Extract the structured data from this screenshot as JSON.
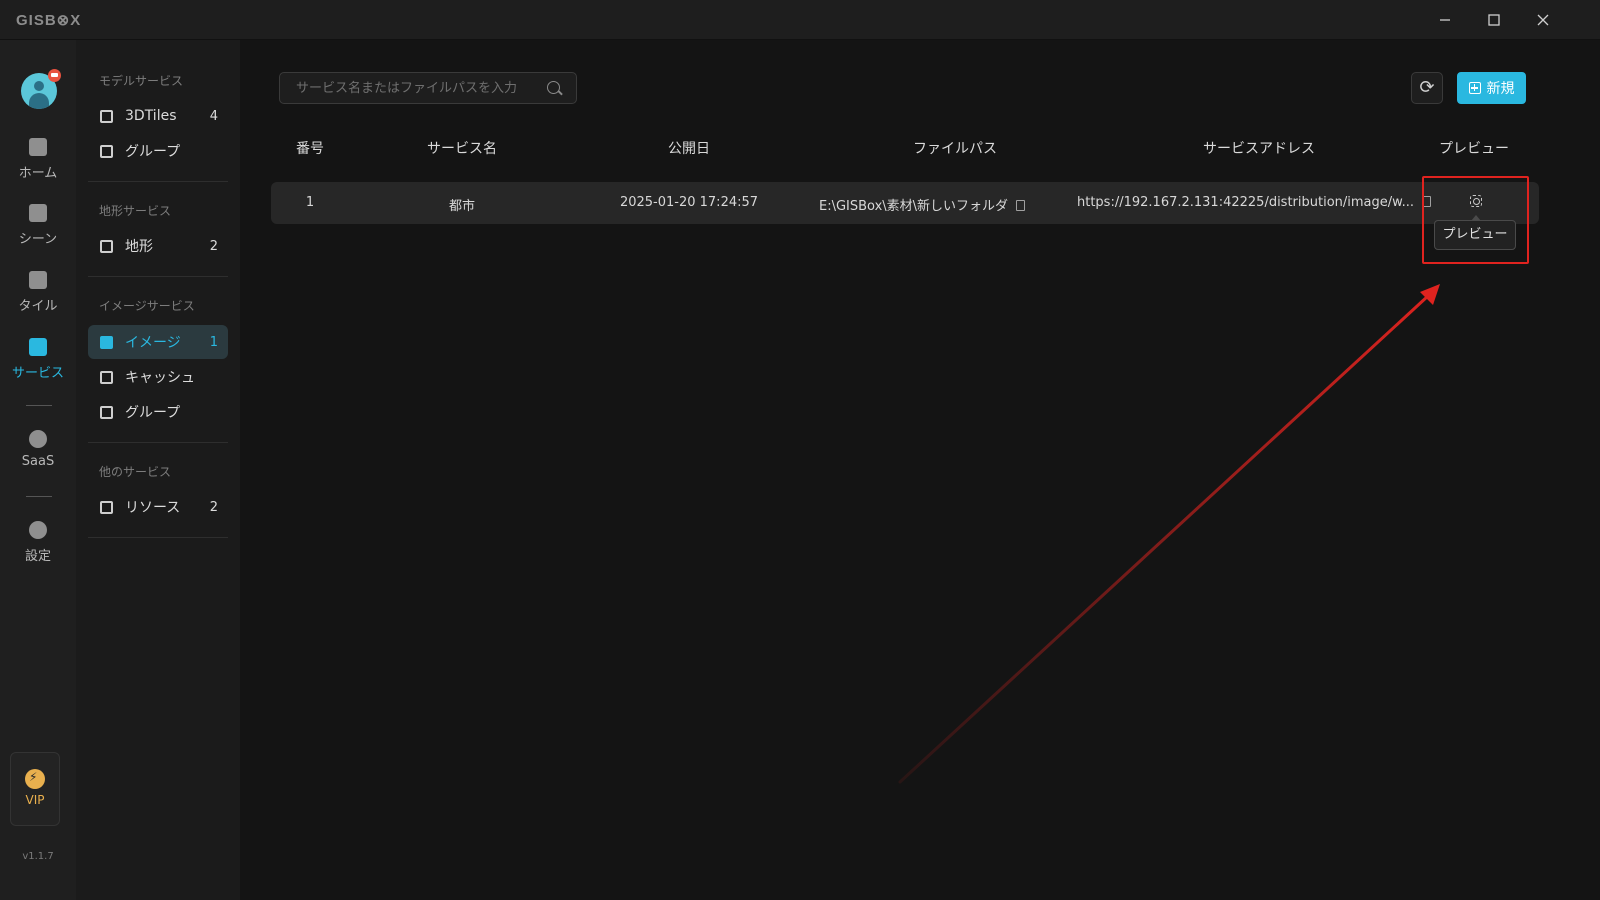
{
  "app": {
    "logo": "GISB⊗X",
    "version": "v1.1.7"
  },
  "window_controls": [
    "minimize",
    "maximize",
    "close"
  ],
  "rail": {
    "items": [
      {
        "label": "ホーム",
        "icon": "home-icon"
      },
      {
        "label": "シーン",
        "icon": "scene-icon"
      },
      {
        "label": "タイル",
        "icon": "tile-icon"
      },
      {
        "label": "サービス",
        "icon": "service-icon",
        "active": true
      },
      {
        "label": "SaaS",
        "icon": "saas-icon"
      },
      {
        "label": "設定",
        "icon": "settings-icon"
      }
    ],
    "vip_label": "VIP"
  },
  "subnav": {
    "sections": [
      {
        "title": "モデルサービス",
        "items": [
          {
            "label": "3DTiles",
            "count": "4"
          },
          {
            "label": "グループ",
            "count": ""
          }
        ]
      },
      {
        "title": "地形サービス",
        "items": [
          {
            "label": "地形",
            "count": "2"
          }
        ]
      },
      {
        "title": "イメージサービス",
        "items": [
          {
            "label": "イメージ",
            "count": "1",
            "active": true
          },
          {
            "label": "キャッシュ",
            "count": ""
          },
          {
            "label": "グループ",
            "count": ""
          }
        ]
      },
      {
        "title": "他のサービス",
        "items": [
          {
            "label": "リソース",
            "count": "2"
          }
        ]
      }
    ]
  },
  "toolbar": {
    "search_placeholder": "サービス名またはファイルパスを入力",
    "new_label": "新規"
  },
  "table": {
    "columns": [
      "番号",
      "サービス名",
      "公開日",
      "ファイルパス",
      "サービスアドレス",
      "プレビュー"
    ],
    "rows": [
      {
        "no": "1",
        "name": "都市",
        "date": "2025-01-20 17:24:57",
        "path": "E:\\GISBox\\素材\\新しいフォルダ",
        "address": "https://192.167.2.131:42225/distribution/image/w..."
      }
    ]
  },
  "tooltip": "プレビュー",
  "colors": {
    "accent": "#2ab8e0",
    "annotation": "#e0231f",
    "background": "#141414",
    "vip": "#e9b04e"
  }
}
